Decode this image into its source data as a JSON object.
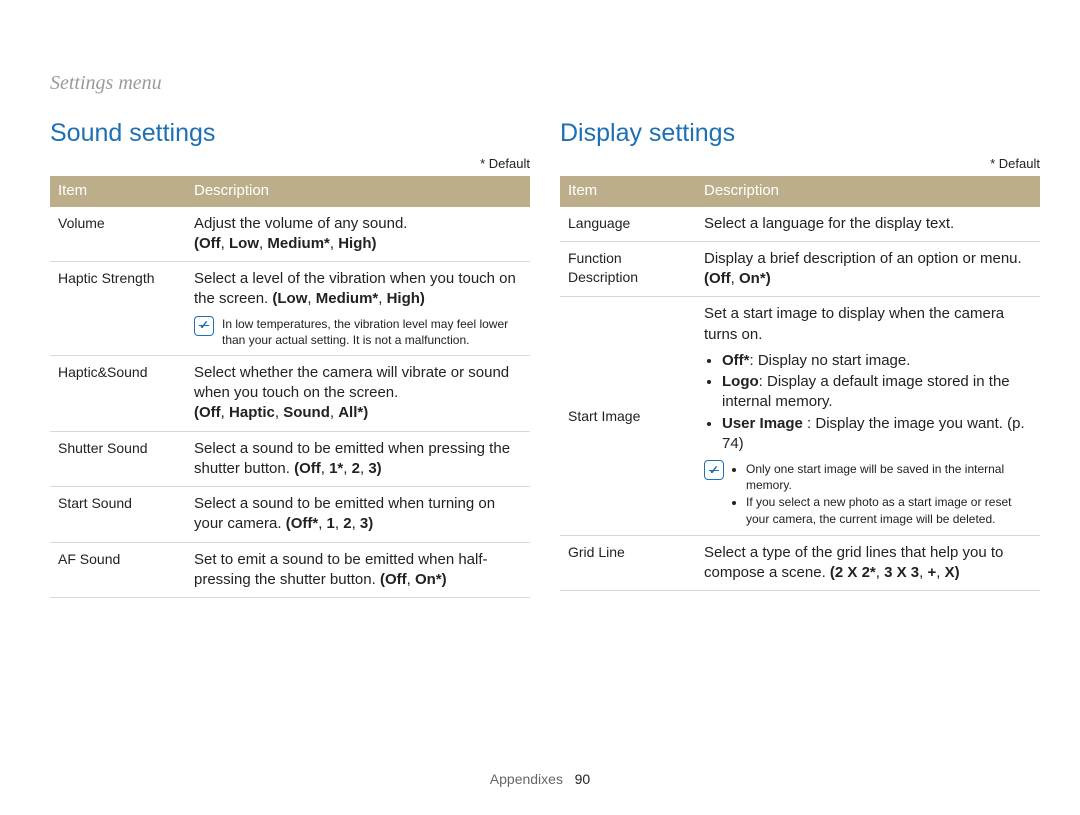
{
  "breadcrumb": "Settings menu",
  "default_note": "* Default",
  "table_headers": {
    "item": "Item",
    "description": "Description"
  },
  "sound": {
    "title": "Sound settings",
    "rows": {
      "volume": {
        "item": "Volume",
        "desc": "Adjust the volume of any sound.",
        "options_prefix": "(",
        "options": [
          "Off",
          "Low",
          "Medium*",
          "High"
        ],
        "options_suffix": ")"
      },
      "haptic_strength": {
        "item": "Haptic Strength",
        "desc": "Select a level of the vibration when you touch on the screen. ",
        "options_prefix": "(",
        "options": [
          "Low",
          "Medium*",
          "High"
        ],
        "options_suffix": ")",
        "note": "In low temperatures, the vibration level may feel lower than your actual setting. It is not a malfunction."
      },
      "haptic_sound": {
        "item": "Haptic&Sound",
        "desc": "Select whether the camera will vibrate or sound when you touch on the screen.",
        "options_prefix": "(",
        "options": [
          "Off",
          "Haptic",
          "Sound",
          "All*"
        ],
        "options_suffix": ")"
      },
      "shutter_sound": {
        "item": "Shutter Sound",
        "desc": "Select a sound to be emitted when pressing the shutter button. ",
        "options_prefix": "(",
        "options": [
          "Off",
          "1*",
          "2",
          "3"
        ],
        "options_suffix": ")"
      },
      "start_sound": {
        "item": "Start Sound",
        "desc": "Select a sound to be emitted when turning on your camera. ",
        "options_prefix": "(",
        "options": [
          "Off*",
          "1",
          "2",
          "3"
        ],
        "options_suffix": ")"
      },
      "af_sound": {
        "item": "AF Sound",
        "desc": "Set to emit a sound to be emitted when half-pressing the shutter button. ",
        "options_prefix": "(",
        "options": [
          "Off",
          "On*"
        ],
        "options_suffix": ")"
      }
    }
  },
  "display": {
    "title": "Display settings",
    "rows": {
      "language": {
        "item": "Language",
        "desc": "Select a language for the display text."
      },
      "func_desc": {
        "item": "Function Description",
        "desc": "Display a brief description of an option or menu.",
        "options_prefix": "(",
        "options": [
          "Off",
          "On*"
        ],
        "options_suffix": ")"
      },
      "start_image": {
        "item": "Start Image",
        "intro": "Set a start image to display when the camera turns on.",
        "bullets": {
          "b1": {
            "label": "Off*",
            "text": ": Display no start image."
          },
          "b2": {
            "label": "Logo",
            "text": ": Display a default image stored in the internal memory."
          },
          "b3": {
            "label": "User Image",
            "text": " : Display the image you want. (p. 74)"
          }
        },
        "notes": {
          "n1": "Only one start image will be saved in the internal memory.",
          "n2": "If you select a new photo as a start image or reset your camera, the current image will be deleted."
        }
      },
      "grid_line": {
        "item": "Grid Line",
        "desc": "Select a type of the grid lines that help you to compose a scene. ",
        "options_prefix": "(",
        "options": [
          "2 X 2*",
          "3 X 3",
          "+",
          "X"
        ],
        "options_suffix": ")"
      }
    }
  },
  "footer": {
    "section": "Appendixes",
    "page": "90"
  },
  "icon_glyph": "✓"
}
